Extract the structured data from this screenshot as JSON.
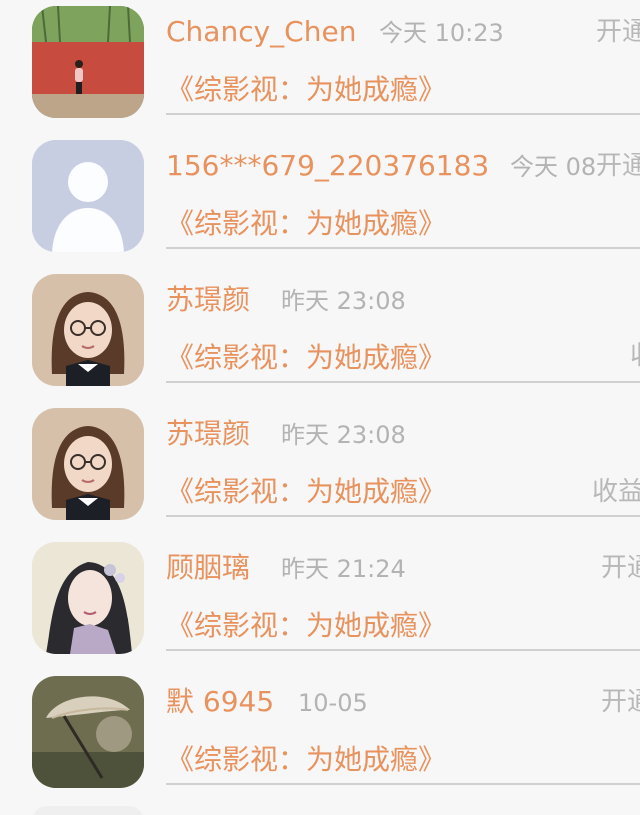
{
  "rows": [
    {
      "name": "Chancy_Chen",
      "time": "今天 10:23",
      "status": "开通",
      "book": "《综影视：为她成瘾》"
    },
    {
      "name": "156***679_220376183",
      "time": "今天 08",
      "status": "开通",
      "book": "《综影视：为她成瘾》"
    },
    {
      "name": "苏璟颜",
      "time": "昨天 23:08",
      "status": "收",
      "book": "《综影视：为她成瘾》"
    },
    {
      "name": "苏璟颜",
      "time": "昨天 23:08",
      "status": "收益",
      "book": "《综影视：为她成瘾》"
    },
    {
      "name": "顾胭璃",
      "time": "昨天 21:24",
      "status": "开通",
      "book": "《综影视：为她成瘾》"
    },
    {
      "name": "默 6945",
      "time": "10-05",
      "status": "开通",
      "book": "《综影视：为她成瘾》"
    }
  ]
}
